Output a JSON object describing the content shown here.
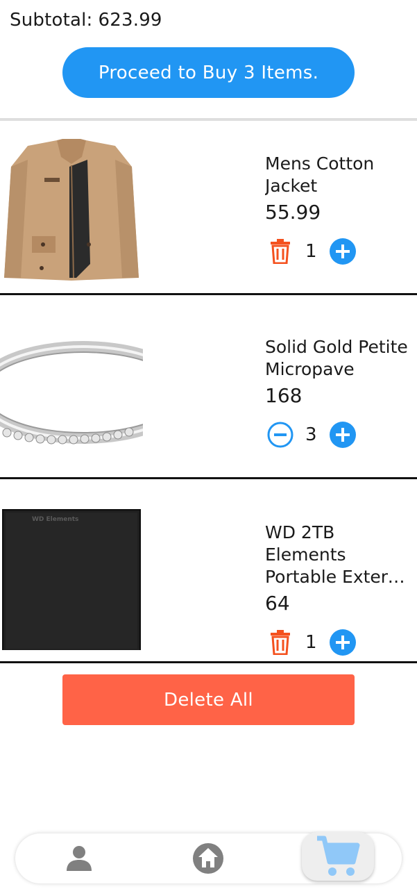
{
  "header": {
    "subtotal_label": "Subtotal:",
    "subtotal_value": "623.99",
    "proceed_label": "Proceed to Buy 3 Items."
  },
  "items": [
    {
      "name_line1": "Mens Cotton",
      "name_line2": "Jacket",
      "price": "55.99",
      "quantity": "1",
      "left_action": "trash-icon",
      "thumbnail": "tan-jacket"
    },
    {
      "name_line1": "Solid Gold Petite",
      "name_line2": "Micropave",
      "price": "168",
      "quantity": "3",
      "left_action": "minus-circle-icon",
      "thumbnail": "silver-ring"
    },
    {
      "name_line1": "WD 2TB Elements",
      "name_line2": "Portable External Hard Drive",
      "price": "64",
      "quantity": "1",
      "left_action": "trash-icon",
      "thumbnail": "black-hard-drive",
      "thumbnail_text": "WD Elements"
    }
  ],
  "footer": {
    "delete_all_label": "Delete All"
  },
  "bottom_nav": {
    "items": [
      {
        "icon": "person-icon"
      },
      {
        "icon": "home-icon"
      },
      {
        "icon": "cart-icon",
        "active": true
      }
    ]
  },
  "colors": {
    "primary_blue": "#2196f3",
    "delete_red": "#ff6347",
    "trash_red": "#f4511e",
    "nav_gray": "#808080",
    "cart_light_blue": "#90c8f8"
  }
}
